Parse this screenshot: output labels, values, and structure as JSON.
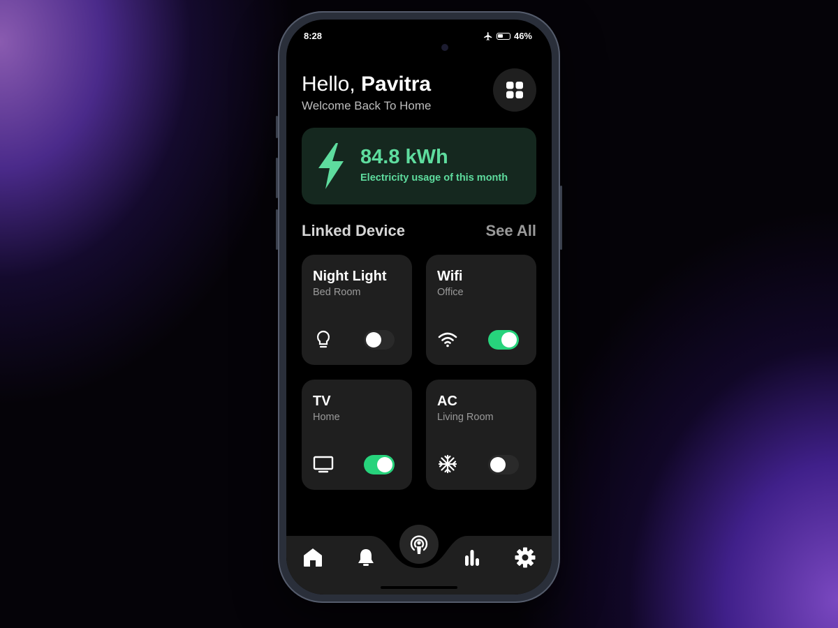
{
  "status_bar": {
    "time": "8:28",
    "battery": "46%"
  },
  "header": {
    "greeting_prefix": "Hello,",
    "user_name": "Pavitra",
    "subtitle": "Welcome Back To Home"
  },
  "energy": {
    "value": "84.8 kWh",
    "label": "Electricity usage of this month",
    "accent": "#5edc9e"
  },
  "devices_section": {
    "title": "Linked Device",
    "see_all": "See All"
  },
  "devices": [
    {
      "name": "Night Light",
      "room": "Bed Room",
      "icon": "lightbulb-icon",
      "on": false
    },
    {
      "name": "Wifi",
      "room": "Office",
      "icon": "wifi-icon",
      "on": true
    },
    {
      "name": "TV",
      "room": "Home",
      "icon": "tv-icon",
      "on": true
    },
    {
      "name": "AC",
      "room": "Living Room",
      "icon": "snowflake-icon",
      "on": false
    }
  ],
  "nav": [
    {
      "icon": "home-icon"
    },
    {
      "icon": "bell-icon"
    },
    {
      "icon": "podcast-icon"
    },
    {
      "icon": "bar-chart-icon"
    },
    {
      "icon": "gear-icon"
    }
  ],
  "colors": {
    "toggle_on": "#27d37c",
    "card": "#1f1f1f",
    "energy_card": "#15281f"
  }
}
